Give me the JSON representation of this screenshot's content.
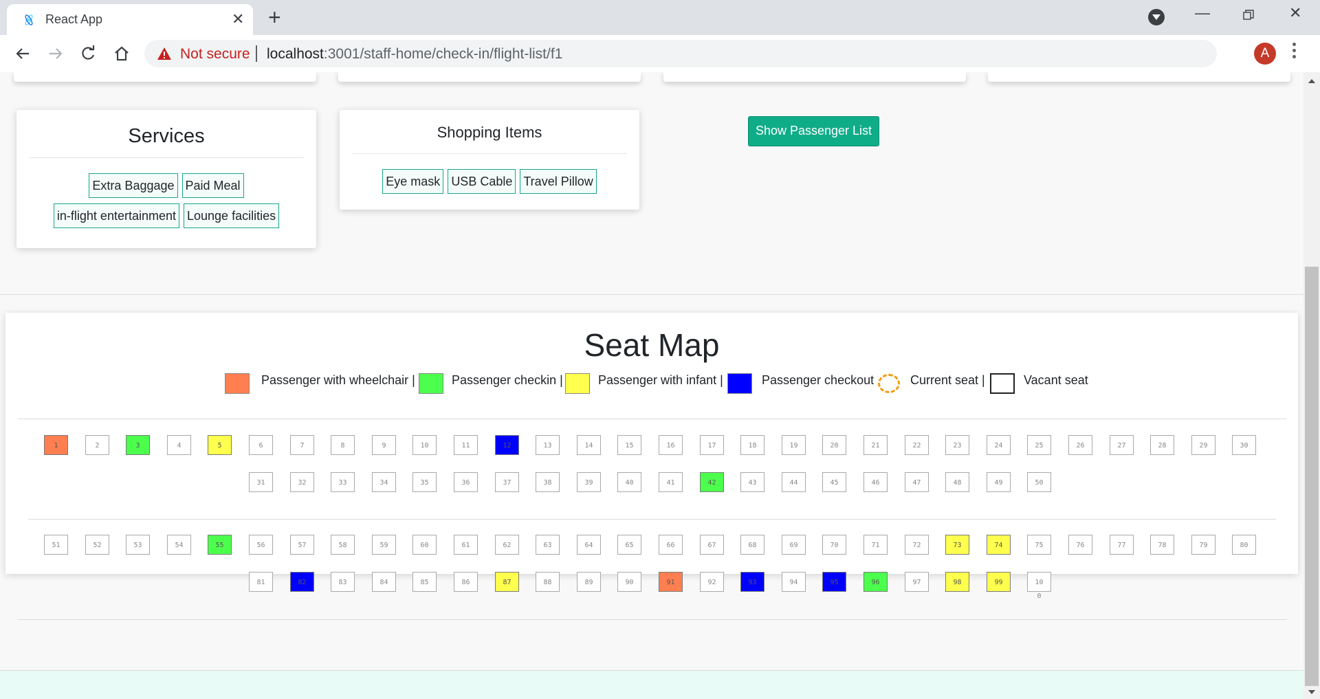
{
  "browser": {
    "tab_title": "React App",
    "url_warning": "Not secure",
    "url_host": "localhost",
    "url_path": ":3001/staff-home/check-in/flight-list/f1",
    "profile_initial": "A"
  },
  "services": {
    "title": "Services",
    "items": [
      "Extra Baggage",
      "Paid Meal",
      "in-flight entertainment",
      "Lounge facilities"
    ]
  },
  "shopping": {
    "title": "Shopping Items",
    "items": [
      "Eye mask",
      "USB Cable",
      "Travel Pillow"
    ]
  },
  "show_passenger_button": "Show Passenger List",
  "seat_map": {
    "title": "Seat Map",
    "legend": [
      {
        "label": "Passenger with wheelchair |",
        "color": "#ff7f50",
        "style": "wheelchair"
      },
      {
        "label": "Passenger checkin |",
        "color": "#4dff4d",
        "style": "checkin"
      },
      {
        "label": "Passenger with infant |",
        "color": "#ffff4d",
        "style": "infant"
      },
      {
        "label": "Passenger checkout",
        "color": "#0000ff",
        "style": "checkout"
      },
      {
        "label": "Current seat |",
        "color": "#f39c12",
        "style": "current"
      },
      {
        "label": "Vacant seat",
        "color": "#ffffff",
        "style": "vacant"
      }
    ],
    "status_colors": {
      "wheelchair": "#ff7f50",
      "checkin": "#4dff4d",
      "infant": "#ffff4d",
      "checkout": "#0000ff",
      "vacant": "#ffffff"
    },
    "seats": [
      {
        "n": "1",
        "s": "wheelchair"
      },
      {
        "n": "2",
        "s": "vacant"
      },
      {
        "n": "3",
        "s": "checkin"
      },
      {
        "n": "4",
        "s": "vacant"
      },
      {
        "n": "5",
        "s": "infant"
      },
      {
        "n": "6",
        "s": "vacant"
      },
      {
        "n": "7",
        "s": "vacant"
      },
      {
        "n": "8",
        "s": "vacant"
      },
      {
        "n": "9",
        "s": "vacant"
      },
      {
        "n": "10",
        "s": "vacant"
      },
      {
        "n": "11",
        "s": "vacant"
      },
      {
        "n": "12",
        "s": "checkout"
      },
      {
        "n": "13",
        "s": "vacant"
      },
      {
        "n": "14",
        "s": "vacant"
      },
      {
        "n": "15",
        "s": "vacant"
      },
      {
        "n": "16",
        "s": "vacant"
      },
      {
        "n": "17",
        "s": "vacant"
      },
      {
        "n": "18",
        "s": "vacant"
      },
      {
        "n": "19",
        "s": "vacant"
      },
      {
        "n": "20",
        "s": "vacant"
      },
      {
        "n": "21",
        "s": "vacant"
      },
      {
        "n": "22",
        "s": "vacant"
      },
      {
        "n": "23",
        "s": "vacant"
      },
      {
        "n": "24",
        "s": "vacant"
      },
      {
        "n": "25",
        "s": "vacant"
      },
      {
        "n": "26",
        "s": "vacant"
      },
      {
        "n": "27",
        "s": "vacant"
      },
      {
        "n": "28",
        "s": "vacant"
      },
      {
        "n": "29",
        "s": "vacant"
      },
      {
        "n": "30",
        "s": "vacant"
      },
      {
        "n": "31",
        "s": "vacant"
      },
      {
        "n": "32",
        "s": "vacant"
      },
      {
        "n": "33",
        "s": "vacant"
      },
      {
        "n": "34",
        "s": "vacant"
      },
      {
        "n": "35",
        "s": "vacant"
      },
      {
        "n": "36",
        "s": "vacant"
      },
      {
        "n": "37",
        "s": "vacant"
      },
      {
        "n": "38",
        "s": "vacant"
      },
      {
        "n": "39",
        "s": "vacant"
      },
      {
        "n": "40",
        "s": "vacant"
      },
      {
        "n": "41",
        "s": "vacant"
      },
      {
        "n": "42",
        "s": "checkin"
      },
      {
        "n": "43",
        "s": "vacant"
      },
      {
        "n": "44",
        "s": "vacant"
      },
      {
        "n": "45",
        "s": "vacant"
      },
      {
        "n": "46",
        "s": "vacant"
      },
      {
        "n": "47",
        "s": "vacant"
      },
      {
        "n": "48",
        "s": "vacant"
      },
      {
        "n": "49",
        "s": "vacant"
      },
      {
        "n": "50",
        "s": "vacant"
      },
      {
        "n": "51",
        "s": "vacant"
      },
      {
        "n": "52",
        "s": "vacant"
      },
      {
        "n": "53",
        "s": "vacant"
      },
      {
        "n": "54",
        "s": "vacant"
      },
      {
        "n": "55",
        "s": "checkin"
      },
      {
        "n": "56",
        "s": "vacant"
      },
      {
        "n": "57",
        "s": "vacant"
      },
      {
        "n": "58",
        "s": "vacant"
      },
      {
        "n": "59",
        "s": "vacant"
      },
      {
        "n": "60",
        "s": "vacant"
      },
      {
        "n": "61",
        "s": "vacant"
      },
      {
        "n": "62",
        "s": "vacant"
      },
      {
        "n": "63",
        "s": "vacant"
      },
      {
        "n": "64",
        "s": "vacant"
      },
      {
        "n": "65",
        "s": "vacant"
      },
      {
        "n": "66",
        "s": "vacant"
      },
      {
        "n": "67",
        "s": "vacant"
      },
      {
        "n": "68",
        "s": "vacant"
      },
      {
        "n": "69",
        "s": "vacant"
      },
      {
        "n": "70",
        "s": "vacant"
      },
      {
        "n": "71",
        "s": "vacant"
      },
      {
        "n": "72",
        "s": "vacant"
      },
      {
        "n": "73",
        "s": "infant"
      },
      {
        "n": "74",
        "s": "infant"
      },
      {
        "n": "75",
        "s": "vacant"
      },
      {
        "n": "76",
        "s": "vacant"
      },
      {
        "n": "77",
        "s": "vacant"
      },
      {
        "n": "78",
        "s": "vacant"
      },
      {
        "n": "79",
        "s": "vacant"
      },
      {
        "n": "80",
        "s": "vacant"
      },
      {
        "n": "81",
        "s": "vacant"
      },
      {
        "n": "82",
        "s": "checkout"
      },
      {
        "n": "83",
        "s": "vacant"
      },
      {
        "n": "84",
        "s": "vacant"
      },
      {
        "n": "85",
        "s": "vacant"
      },
      {
        "n": "86",
        "s": "vacant"
      },
      {
        "n": "87",
        "s": "infant"
      },
      {
        "n": "88",
        "s": "vacant"
      },
      {
        "n": "89",
        "s": "vacant"
      },
      {
        "n": "90",
        "s": "vacant"
      },
      {
        "n": "91",
        "s": "wheelchair"
      },
      {
        "n": "92",
        "s": "vacant"
      },
      {
        "n": "93",
        "s": "checkout"
      },
      {
        "n": "94",
        "s": "vacant"
      },
      {
        "n": "95",
        "s": "checkout"
      },
      {
        "n": "96",
        "s": "checkin"
      },
      {
        "n": "97",
        "s": "vacant"
      },
      {
        "n": "98",
        "s": "infant"
      },
      {
        "n": "99",
        "s": "infant"
      },
      {
        "n": "100",
        "s": "vacant"
      }
    ]
  }
}
